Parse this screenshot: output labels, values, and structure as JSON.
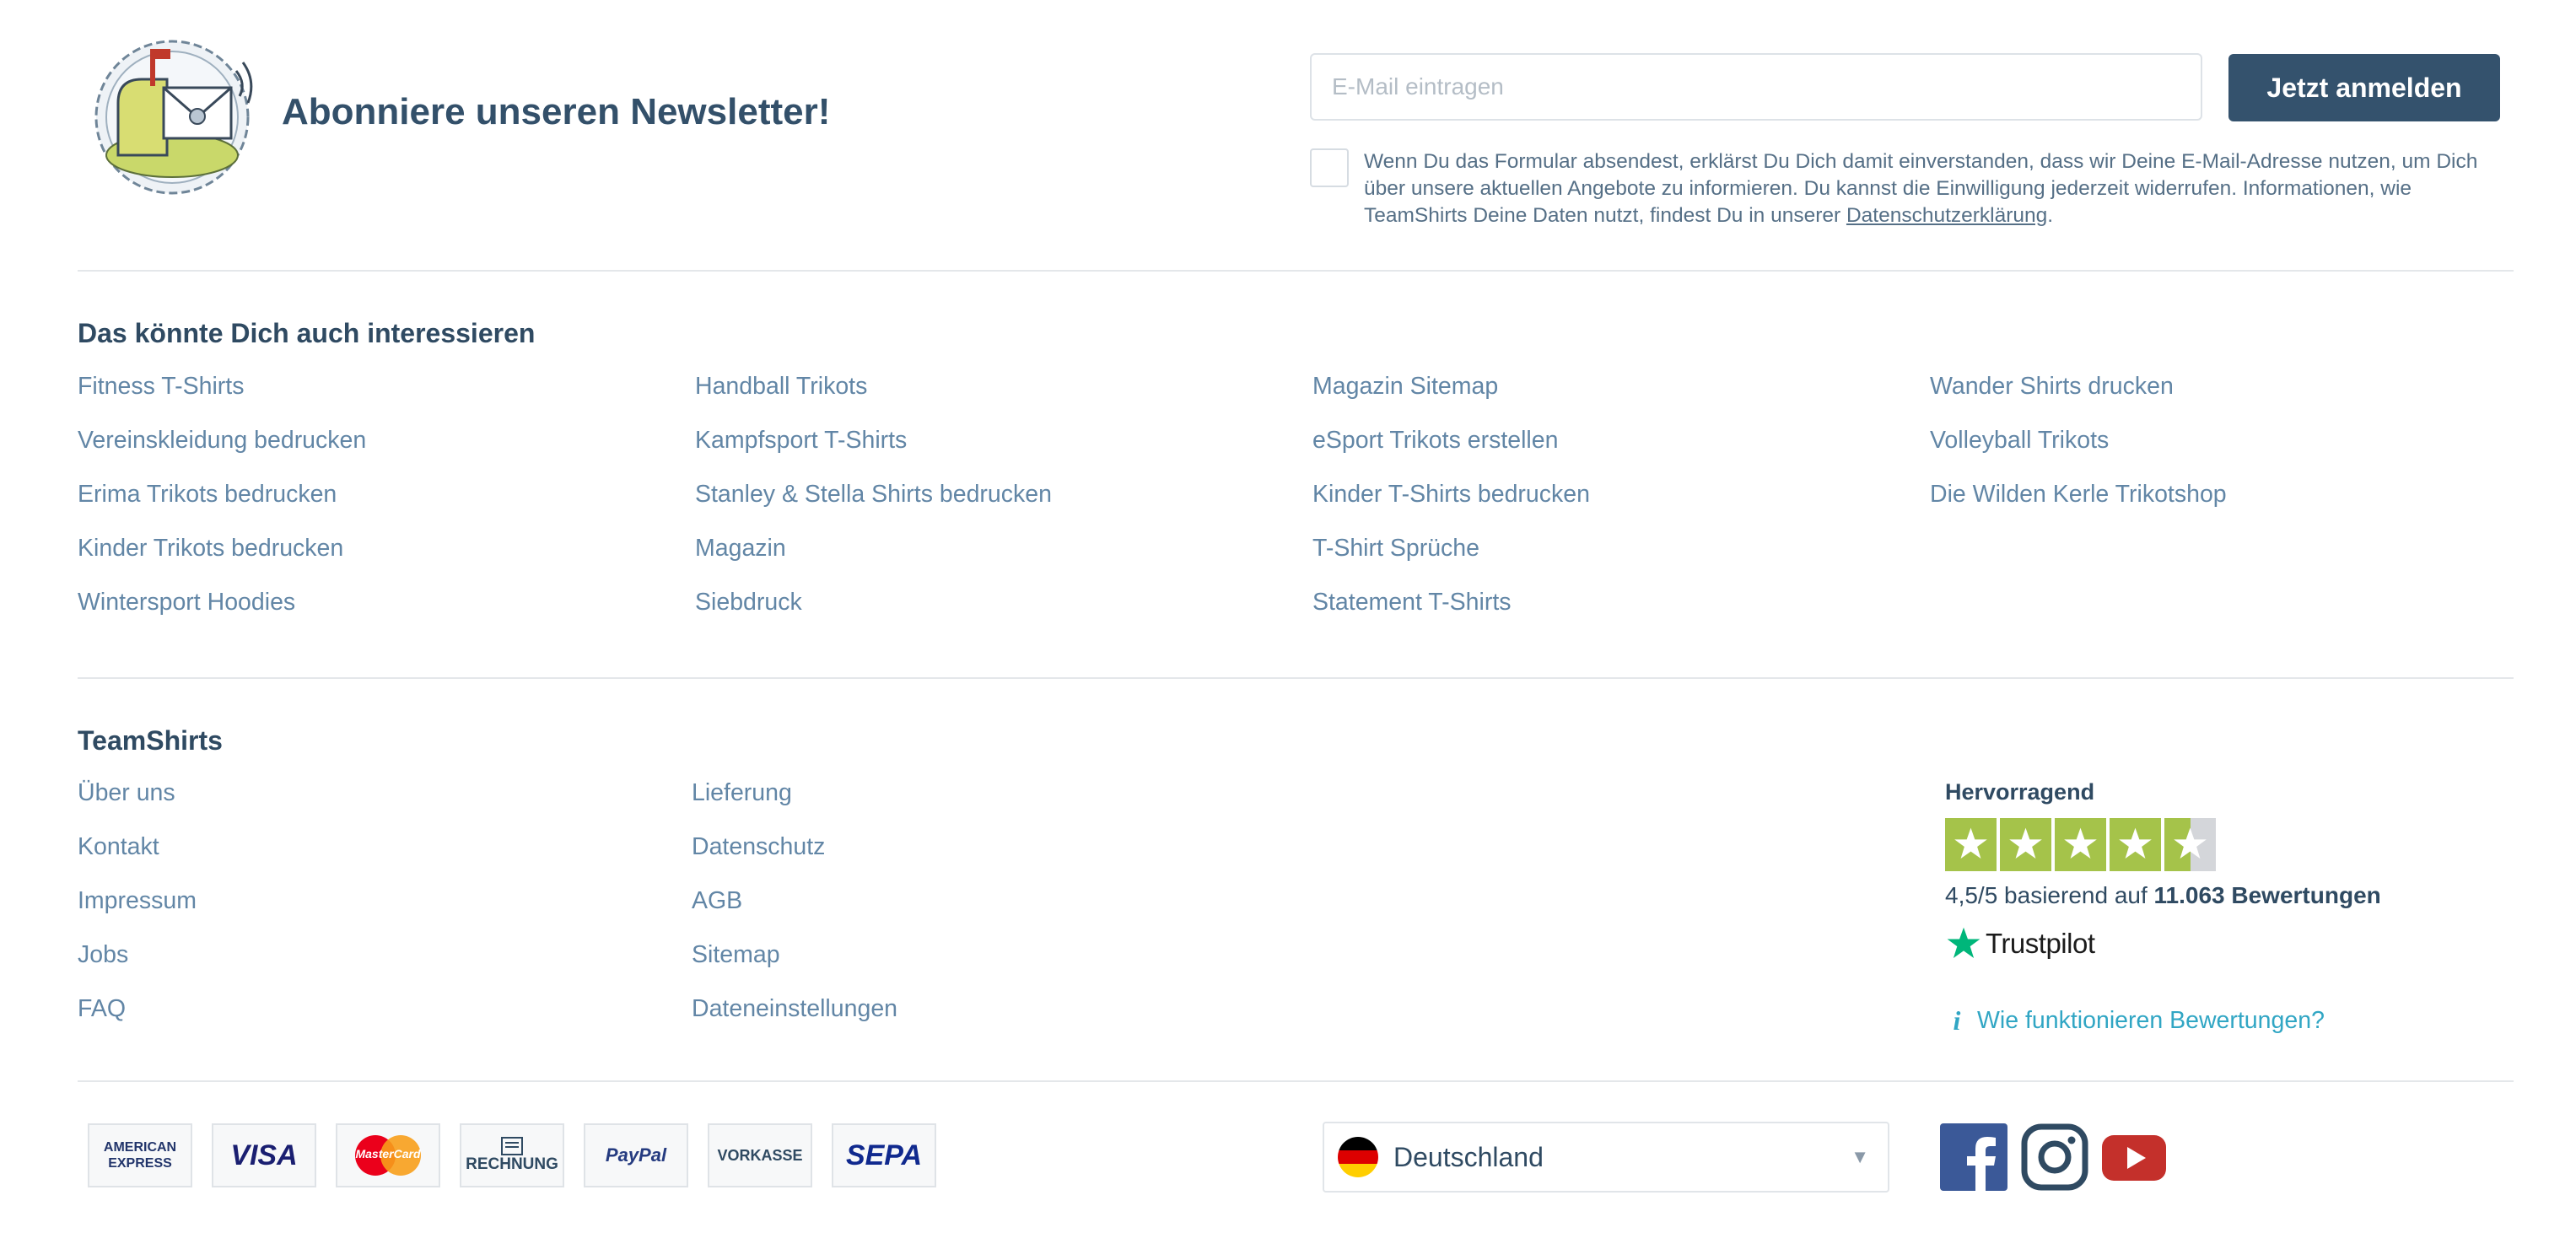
{
  "newsletter": {
    "title": "Abonniere unseren Newsletter!",
    "email_placeholder": "E-Mail eintragen",
    "submit_label": "Jetzt anmelden",
    "consent_text": "Wenn Du das Formular absendest, erklärst Du Dich damit einverstanden, dass wir Deine E-Mail-Adresse nutzen, um Dich über unsere aktuellen Angebote zu informieren. Du kannst die Einwilligung jederzeit widerrufen. Informationen, wie TeamShirts Deine Daten nutzt, findest Du in unserer ",
    "consent_link": "Datenschutzerklärung",
    "consent_end": "."
  },
  "interests": {
    "heading": "Das könnte Dich auch interessieren",
    "columns": [
      [
        "Fitness T-Shirts",
        "Vereinskleidung bedrucken",
        "Erima Trikots bedrucken",
        "Kinder Trikots bedrucken",
        "Wintersport Hoodies"
      ],
      [
        "Handball Trikots",
        "Kampfsport T-Shirts",
        "Stanley & Stella Shirts bedrucken",
        "Magazin",
        "Siebdruck"
      ],
      [
        "Magazin Sitemap",
        "eSport Trikots erstellen",
        "Kinder T-Shirts bedrucken",
        "T-Shirt Sprüche",
        "Statement T-Shirts"
      ],
      [
        "Wander Shirts drucken",
        "Volleyball Trikots",
        "Die Wilden Kerle Trikotshop"
      ]
    ]
  },
  "company": {
    "heading": "TeamShirts",
    "columns": [
      [
        "Über uns",
        "Kontakt",
        "Impressum",
        "Jobs",
        "FAQ"
      ],
      [
        "Lieferung",
        "Datenschutz",
        "AGB",
        "Sitemap",
        "Dateneinstellungen"
      ]
    ]
  },
  "trustpilot": {
    "label": "Hervorragend",
    "stars": 4.5,
    "rating_text": "4,5/5 basierend auf ",
    "reviews_text": "11.063 Bewertungen",
    "brand": "Trustpilot",
    "help_link": "Wie funktionieren Bewertungen?",
    "star_color": "#a5c34a",
    "brand_star_color": "#00b67a"
  },
  "payment": {
    "methods": [
      {
        "name": "american-express",
        "line1": "AMERICAN",
        "line2": "EXPRESS"
      },
      {
        "name": "visa",
        "label": "VISA"
      },
      {
        "name": "mastercard",
        "label": "MasterCard"
      },
      {
        "name": "rechnung",
        "label": "RECHNUNG"
      },
      {
        "name": "paypal",
        "label": "PayPal"
      },
      {
        "name": "vorkasse",
        "label": "VORKASSE"
      },
      {
        "name": "sepa",
        "label": "SEPA"
      }
    ]
  },
  "country": {
    "selected": "Deutschland",
    "caret": "▼"
  },
  "social": {
    "icons": [
      "facebook-icon",
      "instagram-icon",
      "youtube-icon"
    ],
    "facebook_color": "#3b5998",
    "instagram_color": "#2f4a62",
    "youtube_color": "#c4302b"
  }
}
